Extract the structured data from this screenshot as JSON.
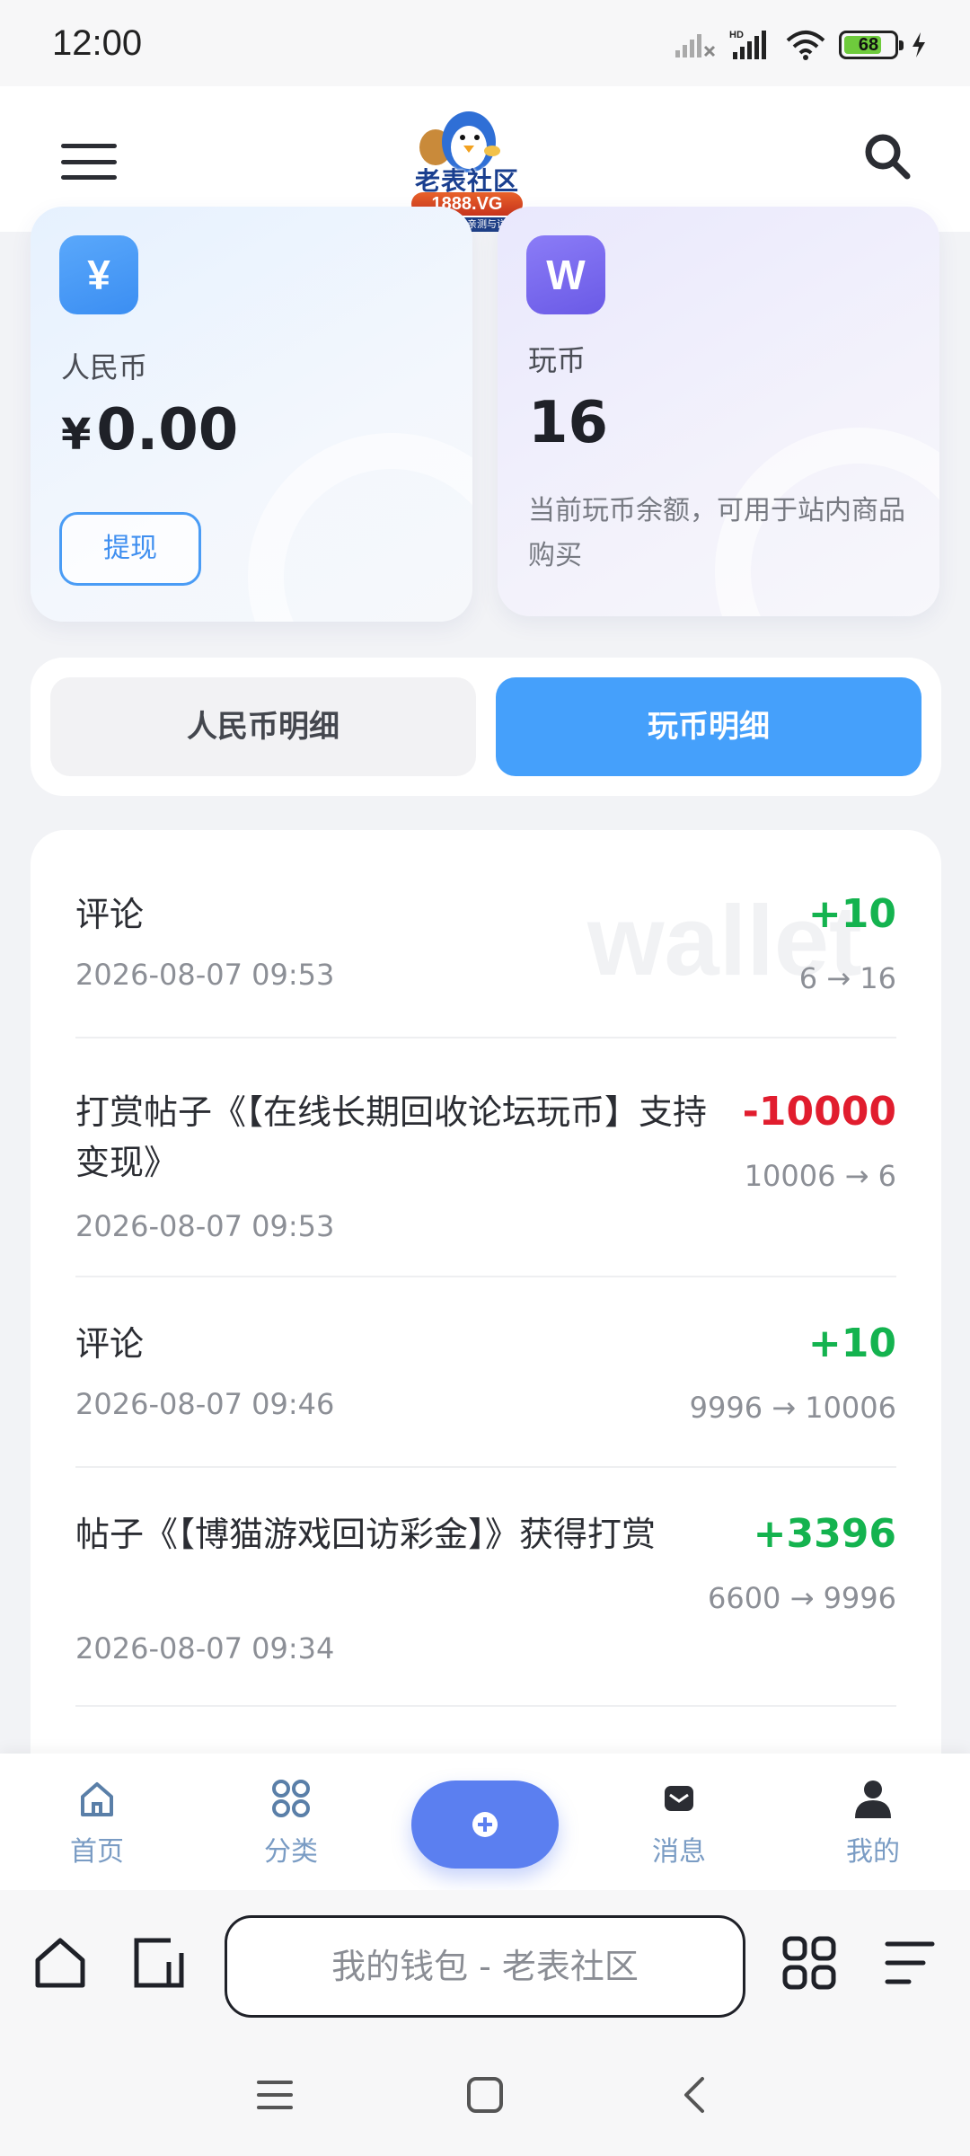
{
  "status_bar": {
    "time": "12:00",
    "battery": "68",
    "network": "HD"
  },
  "header": {
    "logo": {
      "name": "老表社区",
      "badge": "1888.VG",
      "slogan": "真正做到了亲测与详细"
    },
    "menu_icon": "hamburger-icon",
    "search_icon": "search-icon"
  },
  "wallet": {
    "rmb": {
      "icon": "¥",
      "label": "人民币",
      "currency": "¥",
      "amount": "0.00",
      "withdraw_label": "提现"
    },
    "coin": {
      "icon": "W",
      "label": "玩币",
      "amount": "16",
      "description": "当前玩币余额，可用于站内商品购买"
    }
  },
  "tabs": [
    {
      "label": "人民币明细",
      "active": false
    },
    {
      "label": "玩币明细",
      "active": true
    }
  ],
  "watermark": "wallet",
  "transactions": [
    {
      "title": "评论",
      "time": "2026-08-07 09:53",
      "delta": "+10",
      "balance": "6 → 16",
      "type": "positive"
    },
    {
      "title": "打赏帖子《【在线长期回收论坛玩币】支持变现》",
      "time": "2026-08-07 09:53",
      "delta": "-10000",
      "balance": "10006 → 6",
      "type": "negative"
    },
    {
      "title": "评论",
      "time": "2026-08-07 09:46",
      "delta": "+10",
      "balance": "9996 → 10006",
      "type": "positive"
    },
    {
      "title": "帖子《【博猫游戏回访彩金】》获得打赏",
      "time": "2026-08-07 09:34",
      "delta": "+3396",
      "balance": "6600 → 9996",
      "type": "positive"
    }
  ],
  "bottom_nav": [
    {
      "label": "首页",
      "icon": "home-icon"
    },
    {
      "label": "分类",
      "icon": "grid-icon"
    },
    {
      "label": "",
      "icon": "plus-icon"
    },
    {
      "label": "消息",
      "icon": "message-icon"
    },
    {
      "label": "我的",
      "icon": "user-icon"
    }
  ],
  "browser": {
    "address_text": "我的钱包 - 老表社区"
  },
  "colors": {
    "accent": "#45a0fb",
    "positive": "#14b34f",
    "negative": "#e11d2e",
    "fab": "#5b7ff0",
    "nav_label": "#7a9cc4"
  }
}
